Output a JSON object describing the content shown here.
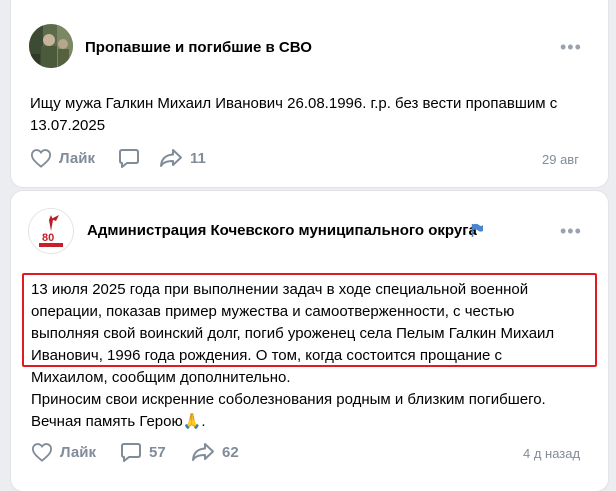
{
  "post1": {
    "group_name": "Пропавшие и погибшие в СВО",
    "text_lines": [
      "Ищу мужа Галкин Михаил Иванович 26.08.1996. г.р. без вести пропавшим с",
      "13.07.2025"
    ],
    "like_label": "Лайк",
    "share_count": "11",
    "date": "29 авг"
  },
  "post2": {
    "group_name": "Администрация Кочевского муниципального округа",
    "avatar_text": "80 ПОБЕДА",
    "text_lines": [
      "13 июля 2025 года при выполнении задач в ходе специальной военной",
      "операции, показав пример мужества и самоотверженности, с честью",
      "выполняя свой воинский долг, погиб уроженец села Пелым Галкин Михаил",
      "Иванович, 1996 года рождения. О том, когда состоится прощание с",
      "Михаилом, сообщим дополнительно.",
      "Приносим свои искренние соболезнования родным и близким погибшего.",
      "Вечная память Герою"
    ],
    "emoji": "🙏",
    "trailing_period": ".",
    "like_label": "Лайк",
    "comment_count": "57",
    "share_count": "62",
    "date": "4 д назад"
  },
  "colors": {
    "accent": "#2688eb",
    "muted": "#818c99",
    "highlight_border": "#e21b23",
    "background": "#ebedf0"
  }
}
